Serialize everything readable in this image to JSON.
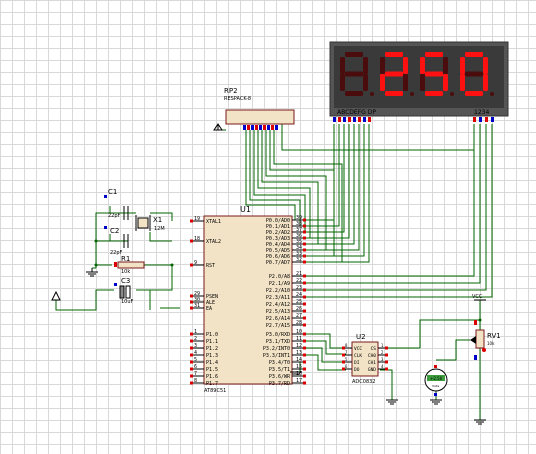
{
  "colors": {
    "wire": "#006400",
    "part_fill": "#f3e3c6",
    "part_border": "#7a1a1a",
    "pin_red": "#dd0000",
    "pin_blue": "#0000cc",
    "segment_on": "#ff1111",
    "segment_off": "#4a0c0c",
    "display_bg": "#5a5a5a",
    "meter_fill": "#3c9c3c"
  },
  "display": {
    "digits": [
      "8",
      "2",
      "5",
      "0"
    ],
    "lit": [
      false,
      true,
      true,
      true
    ],
    "segment_label": "ABCDEFG DP",
    "digit_label": "1234"
  },
  "rp2": {
    "ref": "RP2",
    "value": "RESPACK-8"
  },
  "u1": {
    "ref": "U1",
    "part": "AT89C51",
    "pins_left_top": [
      {
        "num": "19",
        "name": "XTAL1"
      },
      {
        "num": "18",
        "name": "XTAL2"
      },
      {
        "num": "9",
        "name": "RST"
      }
    ],
    "pins_left_mid": [
      {
        "num": "29",
        "name": "PSEN"
      },
      {
        "num": "30",
        "name": "ALE"
      },
      {
        "num": "31",
        "name": "EA"
      }
    ],
    "pins_left_p1": [
      {
        "num": "1",
        "name": "P1.0"
      },
      {
        "num": "2",
        "name": "P1.1"
      },
      {
        "num": "3",
        "name": "P1.2"
      },
      {
        "num": "4",
        "name": "P1.3"
      },
      {
        "num": "5",
        "name": "P1.4"
      },
      {
        "num": "6",
        "name": "P1.5"
      },
      {
        "num": "7",
        "name": "P1.6"
      },
      {
        "num": "8",
        "name": "P1.7"
      }
    ],
    "pins_right_p0": [
      {
        "num": "39",
        "name": "P0.0/AD0"
      },
      {
        "num": "38",
        "name": "P0.1/AD1"
      },
      {
        "num": "37",
        "name": "P0.2/AD2"
      },
      {
        "num": "36",
        "name": "P0.3/AD3"
      },
      {
        "num": "35",
        "name": "P0.4/AD4"
      },
      {
        "num": "34",
        "name": "P0.5/AD5"
      },
      {
        "num": "33",
        "name": "P0.6/AD6"
      },
      {
        "num": "32",
        "name": "P0.7/AD7"
      }
    ],
    "pins_right_p2": [
      {
        "num": "21",
        "name": "P2.0/A8"
      },
      {
        "num": "22",
        "name": "P2.1/A9"
      },
      {
        "num": "23",
        "name": "P2.2/A10"
      },
      {
        "num": "24",
        "name": "P2.3/A11"
      },
      {
        "num": "25",
        "name": "P2.4/A12"
      },
      {
        "num": "26",
        "name": "P2.5/A13"
      },
      {
        "num": "27",
        "name": "P2.6/A14"
      },
      {
        "num": "28",
        "name": "P2.7/A15"
      }
    ],
    "pins_right_p3": [
      {
        "num": "10",
        "name": "P3.0/RXD"
      },
      {
        "num": "11",
        "name": "P3.1/TXD"
      },
      {
        "num": "12",
        "name": "P3.2/INT0"
      },
      {
        "num": "13",
        "name": "P3.3/INT1"
      },
      {
        "num": "14",
        "name": "P3.4/T0"
      },
      {
        "num": "15",
        "name": "P3.5/T1"
      },
      {
        "num": "16",
        "name": "P3.6/WR"
      },
      {
        "num": "17",
        "name": "P3.7/RD"
      }
    ]
  },
  "c1": {
    "ref": "C1",
    "value": "22pF"
  },
  "c2": {
    "ref": "C2",
    "value": "22pF"
  },
  "c3": {
    "ref": "C3",
    "value": "10uF"
  },
  "x1": {
    "ref": "X1",
    "value": "12M"
  },
  "r1": {
    "ref": "R1",
    "value": "10k"
  },
  "u2": {
    "ref": "U2",
    "part": "ADC0832",
    "pins_left": [
      {
        "num": "8",
        "name": "VCC"
      },
      {
        "num": "7",
        "name": "CLK"
      },
      {
        "num": "5",
        "name": "DI"
      },
      {
        "num": "6",
        "name": "DO"
      }
    ],
    "pins_right": [
      {
        "num": "1",
        "name": "CS"
      },
      {
        "num": "2",
        "name": "CH0"
      },
      {
        "num": "3",
        "name": "CH1"
      },
      {
        "num": "4",
        "name": "GND"
      }
    ]
  },
  "rv1": {
    "ref": "RV1",
    "value": "10k"
  },
  "vcc_label": "VCC",
  "meter": {
    "reading": "+2.50",
    "unit": "Volts"
  }
}
